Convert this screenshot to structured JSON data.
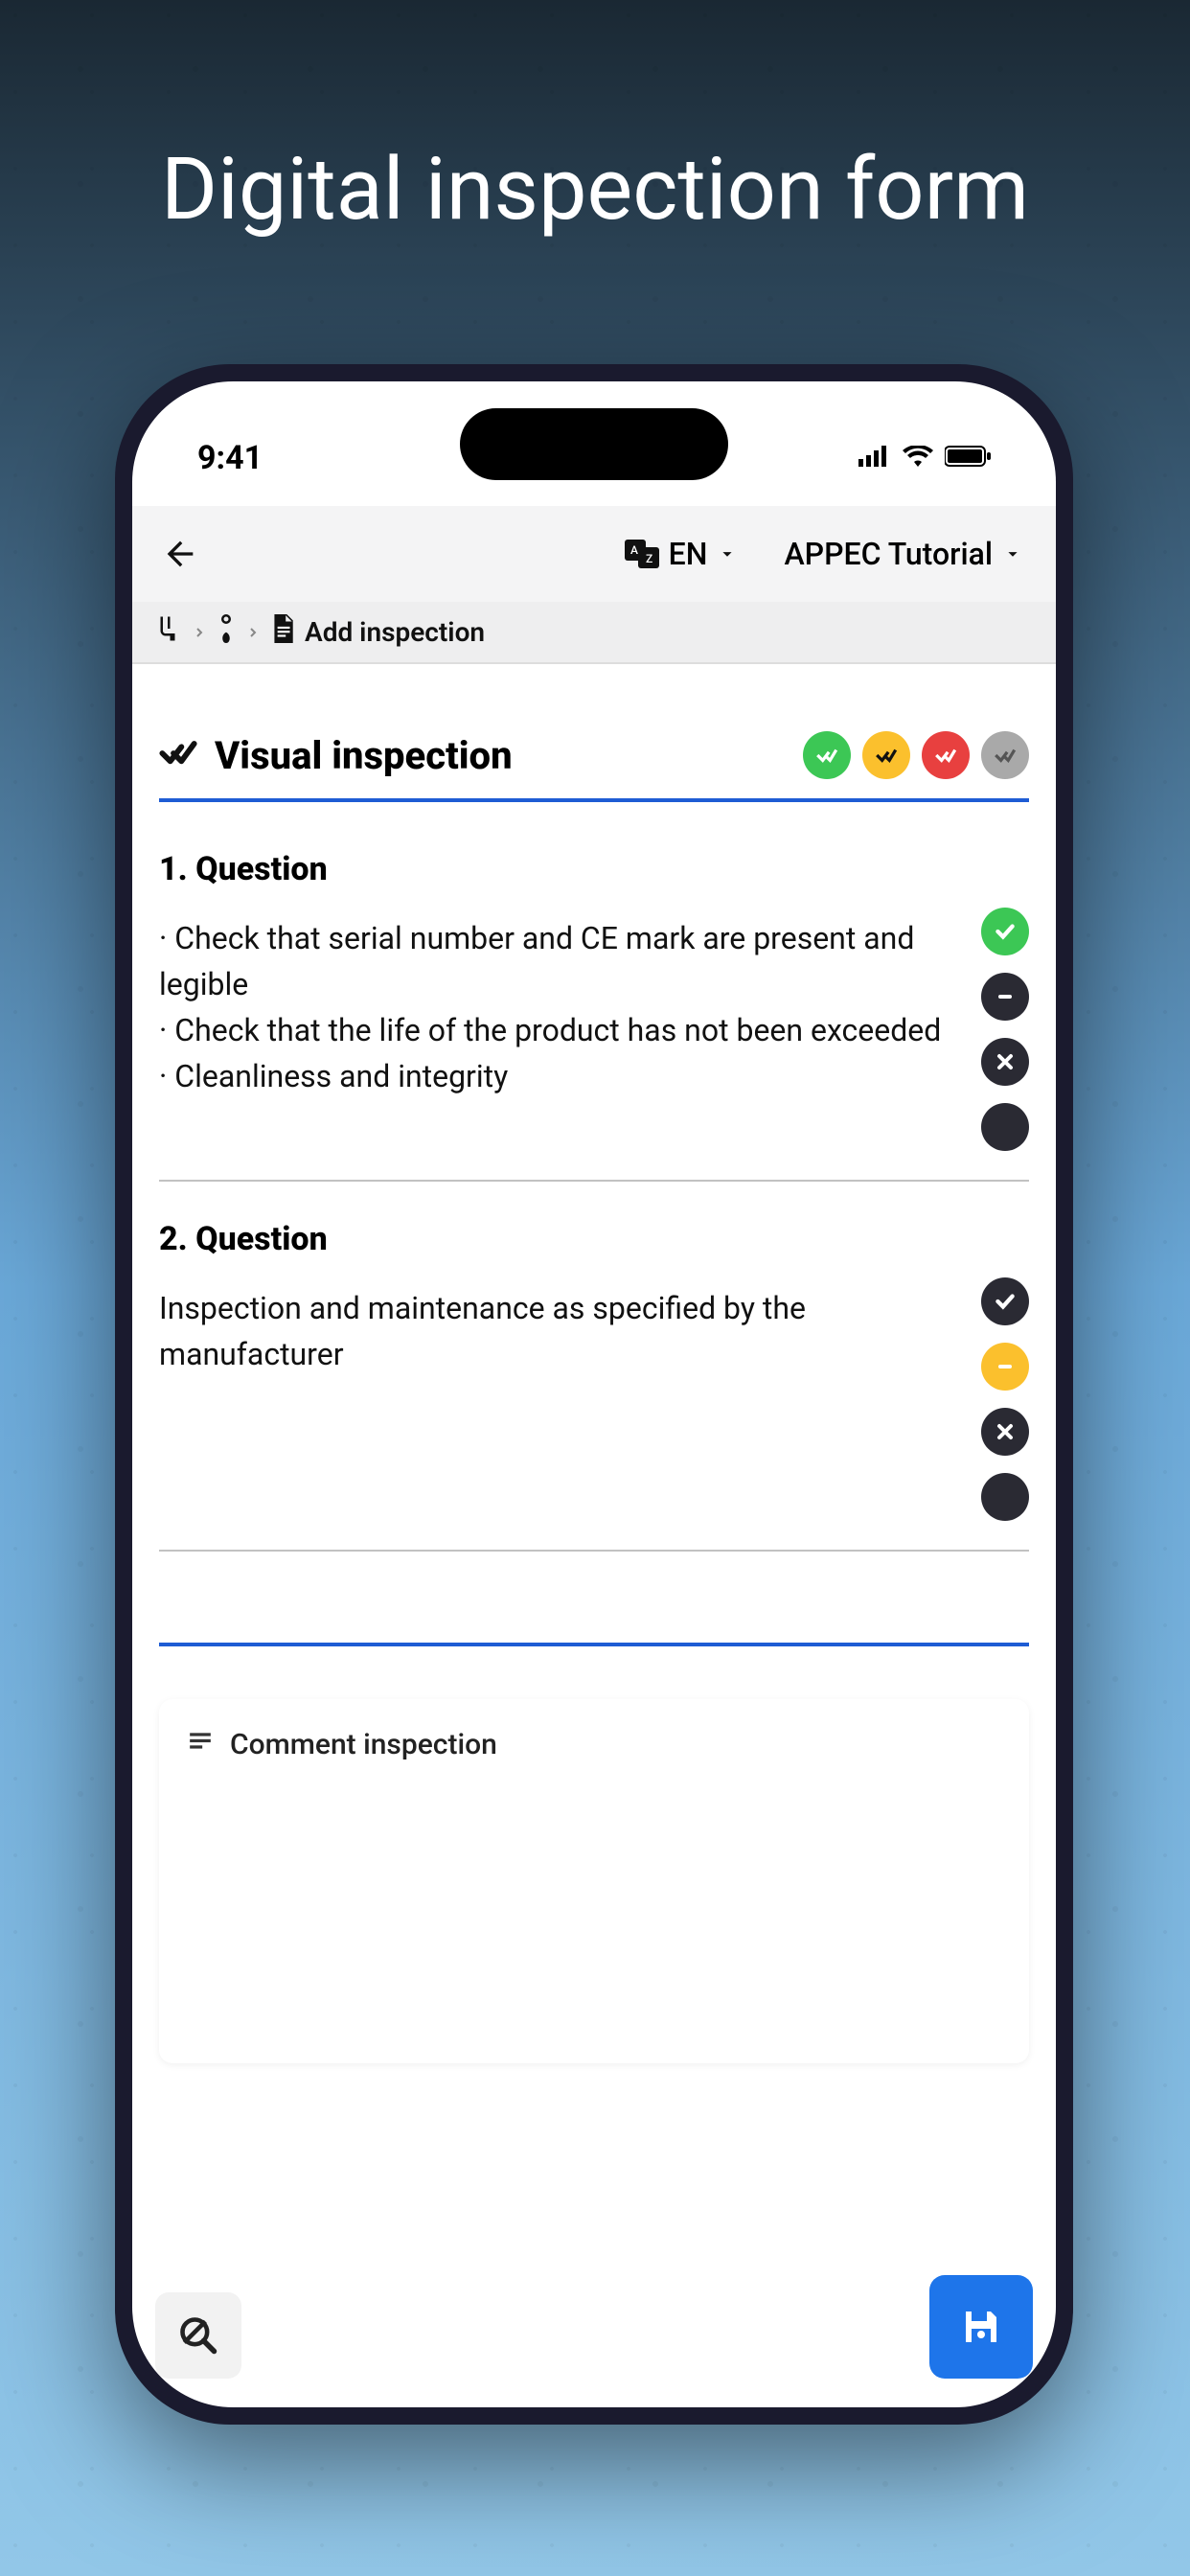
{
  "promo": {
    "title": "Digital inspection form"
  },
  "statusbar": {
    "time": "9:41"
  },
  "nav": {
    "language": "EN",
    "profile": "APPEC Tutorial"
  },
  "breadcrumb": {
    "page": "Add inspection"
  },
  "section": {
    "title": "Visual inspection",
    "badges": [
      "green",
      "yellow",
      "red",
      "gray"
    ]
  },
  "questions": [
    {
      "title": "1. Question",
      "lines": [
        "· Check that serial number and CE mark are present and legible",
        "· Check that the life of the product has not been exceeded",
        "· Cleanliness and integrity"
      ],
      "actions": [
        "ok",
        "minus",
        "cross",
        "dark"
      ]
    },
    {
      "title": "2. Question",
      "lines": [
        "Inspection and maintenance as specified by the manufacturer"
      ],
      "actions": [
        "ok",
        "minus-y",
        "cross",
        "dark"
      ]
    }
  ],
  "comment": {
    "label": "Comment inspection"
  }
}
